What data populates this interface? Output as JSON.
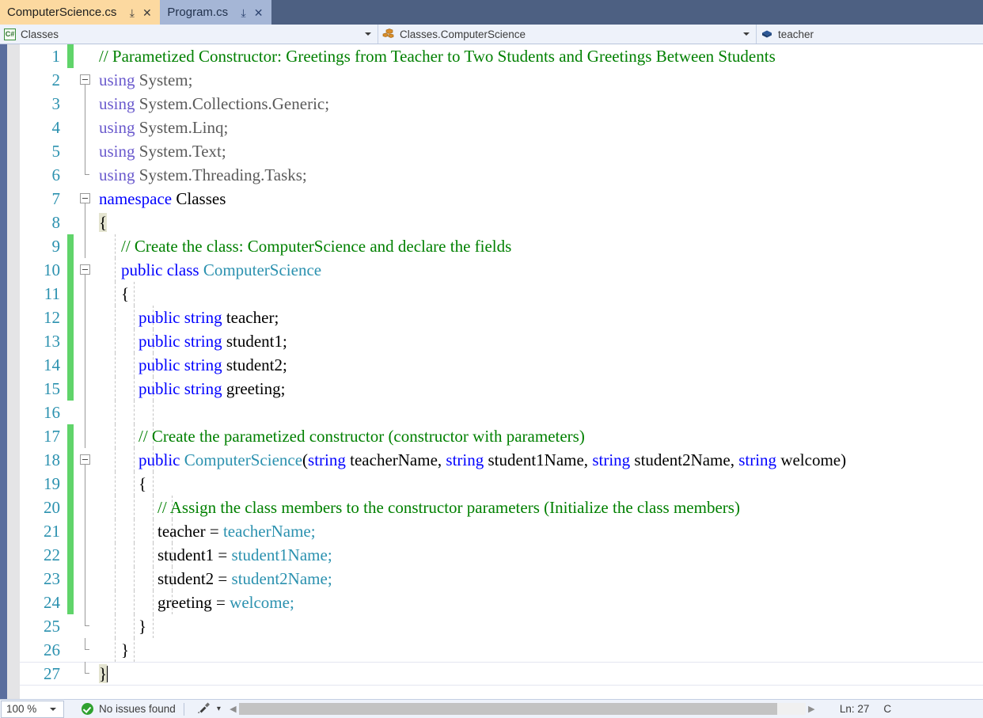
{
  "tabs": [
    {
      "label": "ComputerScience.cs",
      "active": true,
      "pin": "⤓",
      "close": "✕"
    },
    {
      "label": "Program.cs",
      "active": false,
      "pin": "⤓",
      "close": "✕"
    }
  ],
  "navbar": {
    "project": {
      "icon": "csharp-project-icon",
      "label": "Classes",
      "arrow": "▾"
    },
    "type": {
      "icon": "class-icon",
      "label": "Classes.ComputerScience",
      "arrow": "▾"
    },
    "member": {
      "icon": "field-icon",
      "label": "teacher"
    }
  },
  "editor": {
    "lines": [
      {
        "n": "1",
        "change": "green",
        "fold": "none",
        "guides": 0,
        "indent": 0,
        "tokens": [
          {
            "t": "// Parametized Constructor: Greetings from Teacher to Two Students and Greetings Between Students",
            "c": "cm"
          }
        ]
      },
      {
        "n": "2",
        "change": "none",
        "fold": "box",
        "guides": 0,
        "indent": 0,
        "tokens": [
          {
            "t": "using ",
            "c": "pre"
          },
          {
            "t": "System;",
            "c": "gray"
          }
        ]
      },
      {
        "n": "3",
        "change": "none",
        "fold": "line",
        "guides": 0,
        "indent": 0,
        "tokens": [
          {
            "t": "using ",
            "c": "pre"
          },
          {
            "t": "System.Collections.Generic;",
            "c": "gray"
          }
        ]
      },
      {
        "n": "4",
        "change": "none",
        "fold": "line",
        "guides": 0,
        "indent": 0,
        "tokens": [
          {
            "t": "using ",
            "c": "pre"
          },
          {
            "t": "System.Linq;",
            "c": "gray"
          }
        ]
      },
      {
        "n": "5",
        "change": "none",
        "fold": "line",
        "guides": 0,
        "indent": 0,
        "tokens": [
          {
            "t": "using ",
            "c": "pre"
          },
          {
            "t": "System.Text;",
            "c": "gray"
          }
        ]
      },
      {
        "n": "6",
        "change": "none",
        "fold": "elbow",
        "guides": 0,
        "indent": 0,
        "tokens": [
          {
            "t": "using ",
            "c": "pre"
          },
          {
            "t": "System.Threading.Tasks;",
            "c": "gray"
          }
        ]
      },
      {
        "n": "7",
        "change": "none",
        "fold": "box",
        "guides": 0,
        "indent": 0,
        "tokens": [
          {
            "t": "namespace ",
            "c": "k"
          },
          {
            "t": "Classes",
            "c": "id"
          }
        ]
      },
      {
        "n": "8",
        "change": "none",
        "fold": "line",
        "guides": 0,
        "indent": 0,
        "tokens": [
          {
            "t": "{",
            "c": "id brace-hl"
          }
        ]
      },
      {
        "n": "9",
        "change": "green",
        "fold": "line",
        "guides": 1,
        "indent": 1,
        "tokens": [
          {
            "t": "// Create the class: ComputerScience and declare the fields",
            "c": "cm"
          }
        ]
      },
      {
        "n": "10",
        "change": "green",
        "fold": "box",
        "guides": 1,
        "indent": 1,
        "tokens": [
          {
            "t": "public class ",
            "c": "k"
          },
          {
            "t": "ComputerScience",
            "c": "ty"
          }
        ]
      },
      {
        "n": "11",
        "change": "green",
        "fold": "line",
        "guides": 2,
        "indent": 1,
        "tokens": [
          {
            "t": "{",
            "c": "id"
          }
        ]
      },
      {
        "n": "12",
        "change": "green",
        "fold": "line",
        "guides": 3,
        "indent": 2,
        "tokens": [
          {
            "t": "public string ",
            "c": "k"
          },
          {
            "t": "teacher;",
            "c": "id"
          }
        ]
      },
      {
        "n": "13",
        "change": "green",
        "fold": "line",
        "guides": 3,
        "indent": 2,
        "tokens": [
          {
            "t": "public string ",
            "c": "k"
          },
          {
            "t": "student1;",
            "c": "id"
          }
        ]
      },
      {
        "n": "14",
        "change": "green",
        "fold": "line",
        "guides": 3,
        "indent": 2,
        "tokens": [
          {
            "t": "public string ",
            "c": "k"
          },
          {
            "t": "student2;",
            "c": "id"
          }
        ]
      },
      {
        "n": "15",
        "change": "green",
        "fold": "line",
        "guides": 3,
        "indent": 2,
        "tokens": [
          {
            "t": "public string ",
            "c": "k"
          },
          {
            "t": "greeting;",
            "c": "id"
          }
        ]
      },
      {
        "n": "16",
        "change": "none",
        "fold": "line",
        "guides": 3,
        "indent": 2,
        "tokens": []
      },
      {
        "n": "17",
        "change": "green",
        "fold": "line",
        "guides": 3,
        "indent": 2,
        "tokens": [
          {
            "t": "// Create the parametized constructor (constructor with parameters)",
            "c": "cm"
          }
        ]
      },
      {
        "n": "18",
        "change": "green",
        "fold": "box",
        "guides": 3,
        "indent": 2,
        "tokens": [
          {
            "t": "public ",
            "c": "k"
          },
          {
            "t": "ComputerScience",
            "c": "ty"
          },
          {
            "t": "(",
            "c": "id"
          },
          {
            "t": "string ",
            "c": "k"
          },
          {
            "t": "teacherName, ",
            "c": "id"
          },
          {
            "t": "string ",
            "c": "k"
          },
          {
            "t": "student1Name, ",
            "c": "id"
          },
          {
            "t": "string ",
            "c": "k"
          },
          {
            "t": "student2Name, ",
            "c": "id"
          },
          {
            "t": "string ",
            "c": "k"
          },
          {
            "t": "welcome)",
            "c": "id"
          }
        ]
      },
      {
        "n": "19",
        "change": "green",
        "fold": "line",
        "guides": 3,
        "indent": 2,
        "tokens": [
          {
            "t": "{",
            "c": "id"
          }
        ]
      },
      {
        "n": "20",
        "change": "green",
        "fold": "line",
        "guides": 4,
        "indent": 3,
        "tokens": [
          {
            "t": "// Assign the class members to the constructor parameters (Initialize the class members)",
            "c": "cm"
          }
        ]
      },
      {
        "n": "21",
        "change": "green",
        "fold": "line",
        "guides": 4,
        "indent": 3,
        "tokens": [
          {
            "t": "teacher = ",
            "c": "id"
          },
          {
            "t": "teacherName;",
            "c": "pl"
          }
        ]
      },
      {
        "n": "22",
        "change": "green",
        "fold": "line",
        "guides": 4,
        "indent": 3,
        "tokens": [
          {
            "t": "student1 = ",
            "c": "id"
          },
          {
            "t": "student1Name;",
            "c": "pl"
          }
        ]
      },
      {
        "n": "23",
        "change": "green",
        "fold": "line",
        "guides": 4,
        "indent": 3,
        "tokens": [
          {
            "t": "student2 = ",
            "c": "id"
          },
          {
            "t": "student2Name;",
            "c": "pl"
          }
        ]
      },
      {
        "n": "24",
        "change": "green",
        "fold": "line",
        "guides": 4,
        "indent": 3,
        "tokens": [
          {
            "t": "greeting = ",
            "c": "id"
          },
          {
            "t": "welcome;",
            "c": "pl"
          }
        ]
      },
      {
        "n": "25",
        "change": "none",
        "fold": "elbow",
        "guides": 3,
        "indent": 2,
        "tokens": [
          {
            "t": "}",
            "c": "id"
          }
        ]
      },
      {
        "n": "26",
        "change": "none",
        "fold": "elbow",
        "guides": 2,
        "indent": 1,
        "tokens": [
          {
            "t": "}",
            "c": "id"
          }
        ]
      },
      {
        "n": "27",
        "change": "none",
        "fold": "elbow",
        "guides": 0,
        "indent": 0,
        "current": true,
        "tokens": [
          {
            "t": "}",
            "c": "id brace-hl"
          }
        ]
      }
    ]
  },
  "statusbar": {
    "zoom": "100 %",
    "zoom_arrow": "▾",
    "issues_icon": "success-check-icon",
    "issues": "No issues found",
    "cleanup_icon": "code-cleanup-icon",
    "cleanup_arrow": "▾",
    "scroll_left": "◀",
    "scroll_right": "▶",
    "line_pos": "Ln: 27",
    "col_pos": "C"
  }
}
